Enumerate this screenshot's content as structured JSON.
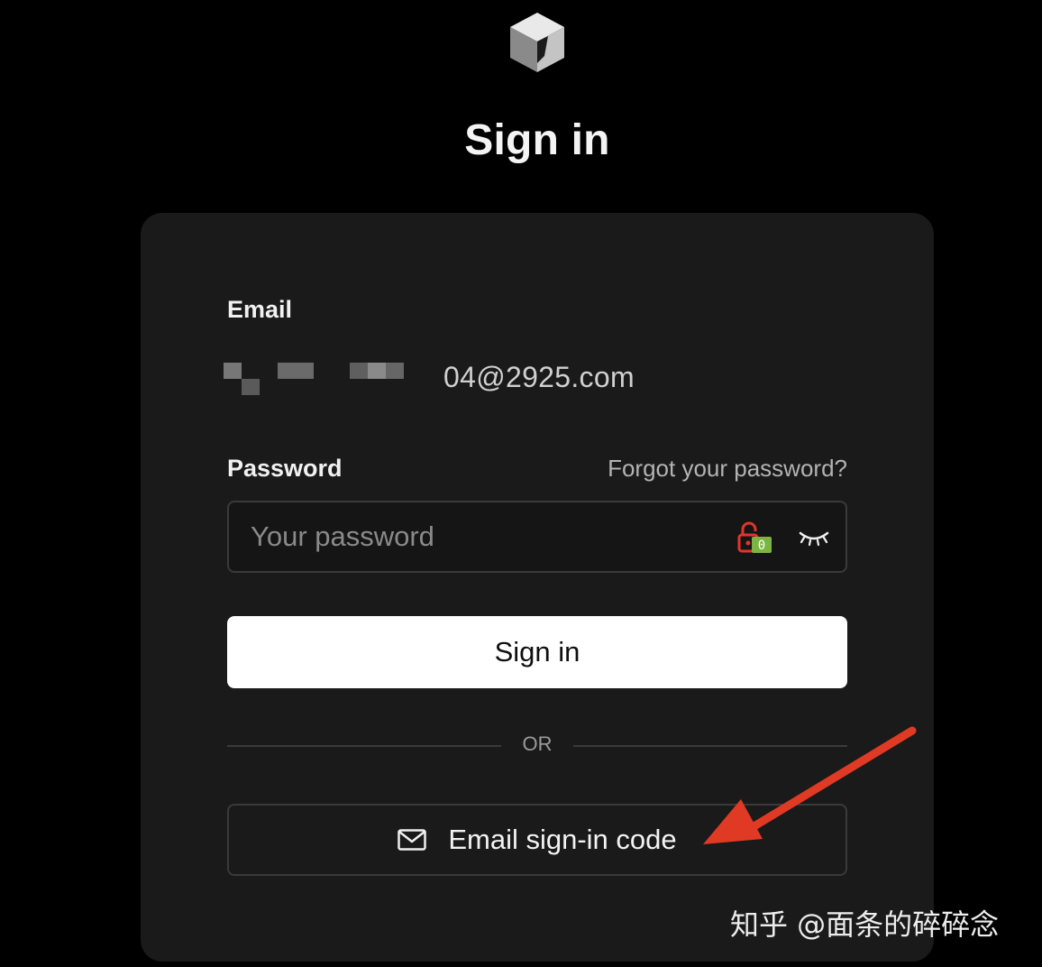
{
  "header": {
    "logo_icon": "cube-logo-icon",
    "title": "Sign in"
  },
  "form": {
    "email_label": "Email",
    "email_value": "04@2925.com",
    "password_label": "Password",
    "forgot_password": "Forgot your password?",
    "password_placeholder": "Your password",
    "password_manager_badge": "0",
    "signin_button": "Sign in",
    "divider_text": "OR",
    "email_code_button": "Email sign-in code"
  },
  "icons": {
    "lock": "password-manager-lock-icon",
    "eye": "eye-closed-icon",
    "mail": "mail-icon"
  },
  "colors": {
    "background": "#000000",
    "card": "#1a1a1a",
    "primary_button": "#ffffff",
    "annotation_arrow": "#e03a24"
  },
  "watermark": "知乎 @面条的碎碎念"
}
